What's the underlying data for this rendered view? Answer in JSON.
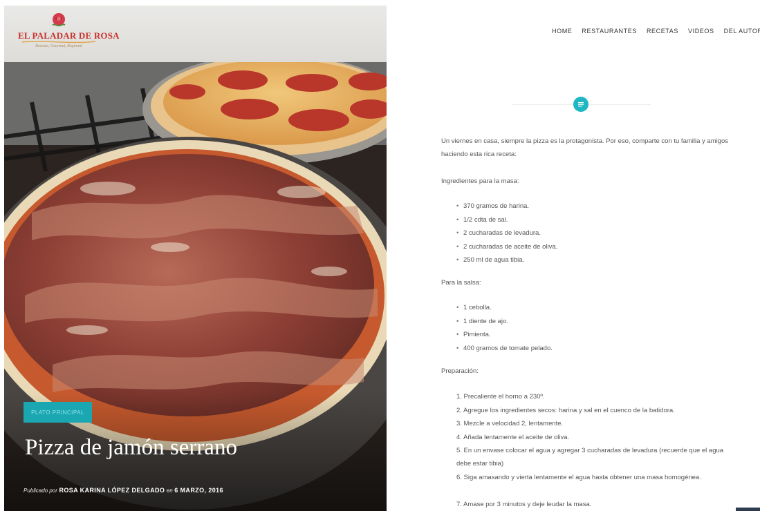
{
  "logo": {
    "title": "EL PALADAR DE ROSA",
    "subtitle": "Recetas, Gourmet, Regional",
    "rose_color": "#d33b4a"
  },
  "nav": {
    "items": [
      {
        "label": "HOME"
      },
      {
        "label": "RESTAURANTES"
      },
      {
        "label": "RECETAS"
      },
      {
        "label": "VIDEOS"
      },
      {
        "label": "DEL AUTOR"
      }
    ]
  },
  "post": {
    "category": "PLATO PRINCIPAL",
    "title": "Pizza de jamón serrano",
    "byline_prefix": "Publicado por",
    "author": "ROSA KARINA LÓPEZ DELGADO",
    "date_prefix": "en",
    "date": "6 MARZO, 2016",
    "format_icon": "text-format-icon",
    "accent_color": "#1fb7c2"
  },
  "content": {
    "intro": "Un viernes en casa, siempre la pizza es la protagonista. Por eso, comparte con tu familia y amigos haciendo esta rica receta:",
    "masa_heading": "Ingredientes para la masa:",
    "masa_items": [
      "370 gramos de harina.",
      "1/2 cdta de sal.",
      "2 cucharadas de levadura.",
      "2 cucharadas de aceite de oliva.",
      "250 ml de agua tibia."
    ],
    "salsa_heading": "Para la salsa:",
    "salsa_items": [
      "1 cebolla.",
      "1 diente de ajo.",
      "Pimienta.",
      "400 gramos de tomate pelado."
    ],
    "prep_heading": "Preparación:",
    "prep_steps": [
      "1.  Precaliente el horno a 230º.",
      "2. Agregue los ingredientes secos: harina y sal en el cuenco de la batidora.",
      "3. Mezcle a velocidad 2, lentamente.",
      "4. Añada lentamente el aceite de oliva.",
      "5. En un envase colocar el agua y agregar 3 cucharadas de levadura (recuerde que el agua debe estar tibia)",
      "6. Siga amasando y vierta lentamente el agua hasta obtener una masa homogénea.",
      "7. Amase por 3 minutos y deje leudar la masa."
    ]
  }
}
